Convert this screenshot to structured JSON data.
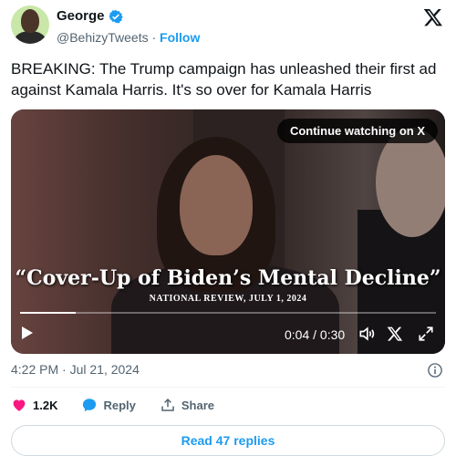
{
  "author": {
    "name": "George",
    "handle": "@BehizyTweets",
    "separator": "·",
    "follow_label": "Follow"
  },
  "tweet": {
    "text": "BREAKING: The Trump campaign has unleashed their first ad against Kamala Harris. It's so over for Kamala Harris",
    "timestamp": "4:22 PM · Jul 21, 2024"
  },
  "video": {
    "continue_label": "Continue watching on X",
    "quote_text": "“Cover-Up of Biden’s Mental Decline”",
    "source_text": "NATIONAL REVIEW, JULY 1, 2024",
    "time_display": "0:04 / 0:30",
    "progress": 0.133
  },
  "actions": {
    "likes": "1.2K",
    "reply_label": "Reply",
    "share_label": "Share"
  },
  "read_replies_label": "Read 47 replies",
  "colors": {
    "accent": "#1d9bf0",
    "like": "#f91880",
    "text": "#0f1419",
    "secondary": "#536471"
  }
}
